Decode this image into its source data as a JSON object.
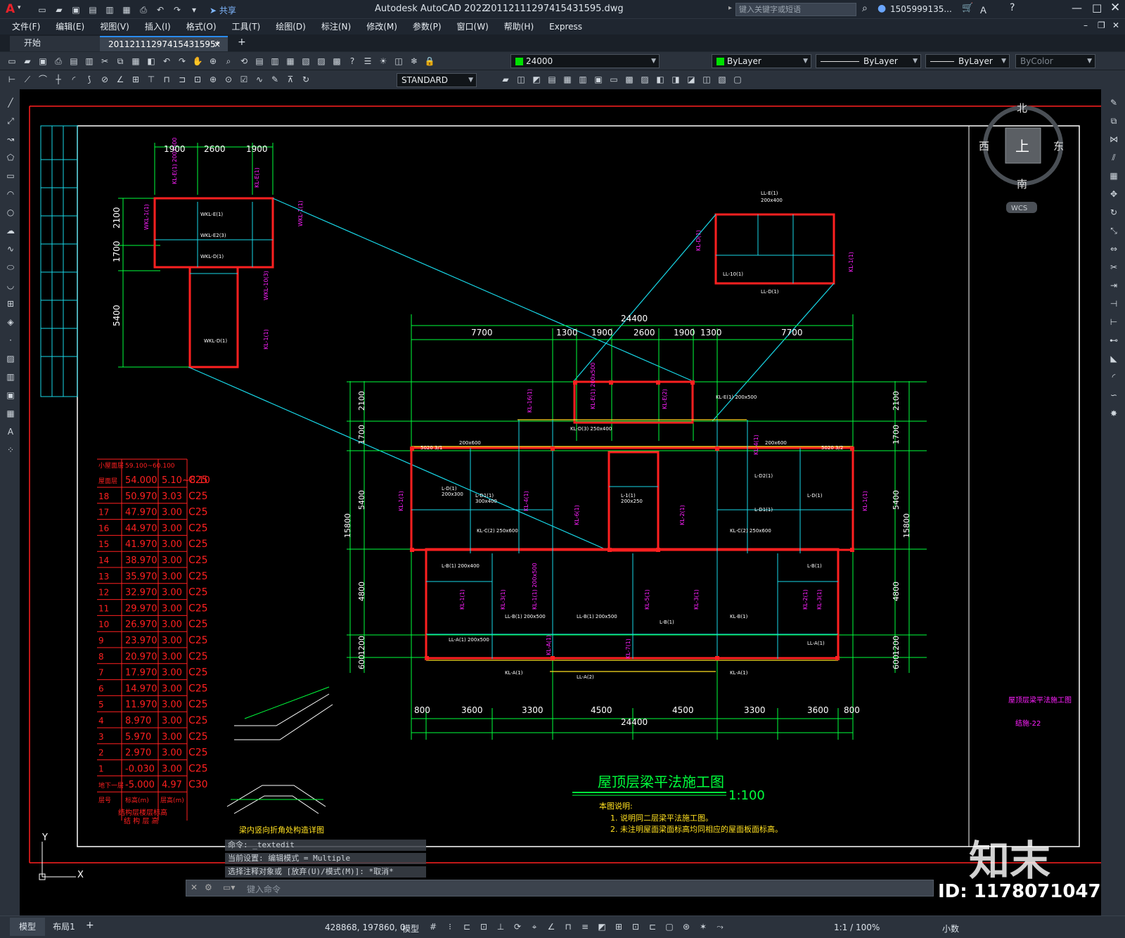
{
  "app": {
    "logo": "A",
    "title": "Autodesk AutoCAD 2022",
    "filename": "20112111297415431595.dwg",
    "search_placeholder": "键入关键字或短语",
    "user": "1505999135...",
    "share": "共享"
  },
  "menu": [
    "文件(F)",
    "编辑(E)",
    "视图(V)",
    "插入(I)",
    "格式(O)",
    "工具(T)",
    "绘图(D)",
    "标注(N)",
    "修改(M)",
    "参数(P)",
    "窗口(W)",
    "帮助(H)",
    "Express"
  ],
  "tabs": {
    "start": "开始",
    "active": "20112111297415431595*",
    "close": "×",
    "add": "+"
  },
  "toolbar": {
    "layer": "24000",
    "color": "ByLayer",
    "linetype": "ByLayer",
    "lineweight": "ByLayer",
    "plotstyle": "ByColor",
    "textstyle": "STANDARD"
  },
  "viewcube": {
    "north": "北",
    "south": "南",
    "east": "东",
    "west": "西",
    "top": "上",
    "wcs": "WCS"
  },
  "drawing": {
    "title": "屋顶层梁平法施工图",
    "scale": "1:100",
    "notes_head": "本图说明:",
    "note1": "1. 说明同二层梁平法施工图。",
    "note2": "2. 未注明屋面梁面标高均同相应的屋面板面标高。",
    "side_title": "屋顶层梁平法施工图",
    "side_num": "结施-22",
    "dims_top": [
      "7700",
      "1300",
      "1900",
      "2600",
      "1900",
      "1300",
      "7700"
    ],
    "dims_bottom": [
      "800",
      "3600",
      "3300",
      "4500",
      "4500",
      "3300",
      "3600",
      "800"
    ],
    "total": "24400",
    "dims_left": [
      "2100",
      "1700",
      "5400",
      "4800",
      "1200",
      "600"
    ],
    "dims_side_total": "15800",
    "detail_dims_top": [
      "1900",
      "2600",
      "1900"
    ],
    "detail_dims_left": [
      "2100",
      "1700",
      "5400"
    ],
    "detail_note": "梁内竖向折角处构造详图",
    "ucs_y": "Y",
    "ucs_x": "X",
    "table": {
      "head_top": "小屋面层",
      "head_top_val": "59.100~60.100",
      "rows": [
        [
          "屋面层",
          "54.000",
          "5.10~8.10",
          "C25"
        ],
        [
          "18",
          "50.970",
          "3.03",
          "C25"
        ],
        [
          "17",
          "47.970",
          "3.00",
          "C25"
        ],
        [
          "16",
          "44.970",
          "3.00",
          "C25"
        ],
        [
          "15",
          "41.970",
          "3.00",
          "C25"
        ],
        [
          "14",
          "38.970",
          "3.00",
          "C25"
        ],
        [
          "13",
          "35.970",
          "3.00",
          "C25"
        ],
        [
          "12",
          "32.970",
          "3.00",
          "C25"
        ],
        [
          "11",
          "29.970",
          "3.00",
          "C25"
        ],
        [
          "10",
          "26.970",
          "3.00",
          "C25"
        ],
        [
          "9",
          "23.970",
          "3.00",
          "C25"
        ],
        [
          "8",
          "20.970",
          "3.00",
          "C25"
        ],
        [
          "7",
          "17.970",
          "3.00",
          "C25"
        ],
        [
          "6",
          "14.970",
          "3.00",
          "C25"
        ],
        [
          "5",
          "11.970",
          "3.00",
          "C25"
        ],
        [
          "4",
          "8.970",
          "3.00",
          "C25"
        ],
        [
          "3",
          "5.970",
          "3.00",
          "C25"
        ],
        [
          "2",
          "2.970",
          "3.00",
          "C25"
        ],
        [
          "1",
          "-0.030",
          "3.00",
          "C25"
        ],
        [
          "地下一层",
          "-5.000",
          "4.97",
          "C30"
        ]
      ],
      "foot_1": "层号",
      "foot_2": "标高(m)",
      "foot_3": "层高(m)",
      "caption": "结构层楼层标高",
      "caption2": "结 构 层 高"
    }
  },
  "command": {
    "line1": "命令: _textedit",
    "line2": "当前设置: 编辑模式 = Multiple",
    "line3": "选择注释对象或 [放弃(U)/模式(M)]: *取消*",
    "placeholder": "键入命令"
  },
  "status": {
    "model_tab": "模型",
    "layout_tab": "布局1",
    "add": "+",
    "coords": "428868, 197860, 0",
    "space": "模型",
    "scale": "1:1 / 100%",
    "units": "小数"
  },
  "watermark": {
    "brand": "知末",
    "id": "ID: 1178071047"
  },
  "colors": {
    "red": "#ff2020",
    "green": "#00ff3c",
    "cyan": "#18d8e8",
    "magenta": "#ff20ff",
    "yellow": "#ffe020",
    "white": "#ffffff"
  }
}
